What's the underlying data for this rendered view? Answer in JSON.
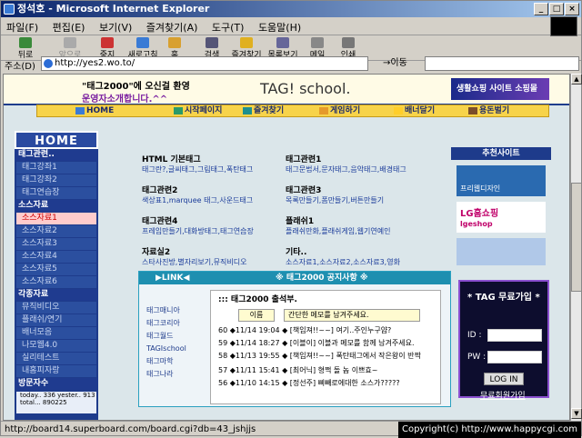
{
  "window": {
    "title": "정석호 - Microsoft Internet Explorer"
  },
  "menu": [
    "파일(F)",
    "편집(E)",
    "보기(V)",
    "즐겨찾기(A)",
    "도구(T)",
    "도움말(H)"
  ],
  "toolbar": [
    "뒤로",
    "앞으로",
    "중지",
    "새로고침",
    "홈",
    "검색",
    "즐겨찾기",
    "목록보기",
    "메일",
    "인쇄"
  ],
  "address": {
    "label": "주소(D)",
    "url": "http://yes2.wo.to/",
    "go": "이동"
  },
  "banner": {
    "line1": "\"태그2000\"에 오신걸 환영",
    "line2": "운영자소개합니다.^^",
    "brand": "TAG! school.",
    "logo_text": "생활쇼핑 사이트 소핑몰"
  },
  "nav": [
    "HOME",
    "시작페이지",
    "즐겨찾기",
    "게임하기",
    "배너달기",
    "용돈벌기"
  ],
  "left": {
    "home": "HOME",
    "sections": [
      {
        "title": "태그관련..",
        "items": [
          "태그강좌1",
          "태그강좌2",
          "태그연습장"
        ]
      },
      {
        "title": "소스자료",
        "items": [
          "소스자료1",
          "소스자료2",
          "소스자료3",
          "소스자료4",
          "소스자료5",
          "소스자료6"
        ]
      },
      {
        "title": "각종자료",
        "items": [
          "뮤직비디오",
          "플래쉬/연기",
          "배너모음",
          "나모웹4.0",
          "실리테스트",
          "내홈피자랑"
        ]
      },
      {
        "title": "방문자수",
        "items": []
      }
    ],
    "visit_text": "today.. 336 yester.. 913 total... 890225"
  },
  "categories": [
    {
      "title": "HTML 기본태그",
      "links": "태그란?,글씨태그,그림태그,폭탄태그"
    },
    {
      "title": "태그관련1",
      "links": "태그문법서,문자태그,음악태그,배경태그"
    },
    {
      "title": "태그관련2",
      "links": "색상표1,marquee 태그,사운드태그"
    },
    {
      "title": "태그관련3",
      "links": "목록만들기,폼만들기,버튼만들기"
    },
    {
      "title": "태그관련4",
      "links": "프레임만들기,대화방태그,태그연습장"
    },
    {
      "title": "플래쉬1",
      "links": "플래쉬만화,플래쉬게임,웹기연예인"
    },
    {
      "title": "자료실2",
      "links": "스타사진방,별자리보기,뮤직비디오"
    },
    {
      "title": "기타..",
      "links": "소스자료1,소스자료2,소스자료3,영화"
    }
  ],
  "recommend": {
    "title": "추천사이트",
    "s1": "프리웹디자인",
    "s2": "LG홈쇼핑",
    "s3": "lgeshop"
  },
  "board": {
    "header_link": "▶LINK◀",
    "header_title": "※ 태그2000 공지사항 ※",
    "links": [
      "태그매니아",
      "태그코리아",
      "태그월드",
      "TAGIschool",
      "태그마학",
      "태그나라"
    ],
    "title": "::: 태그2000 출석부.",
    "cols": [
      "이름",
      "간단한 메모를 남겨주세요."
    ],
    "rows": [
      "60 ◆11/14 19:04 ◆ [책임져!!~~] 여기..주인누구얌?",
      "59 ◆11/14 18:27 ◆ [이블이] 이블과 메모를 함께 남겨주세요.",
      "58 ◆11/13 19:55 ◆ [책임져!!~~] 폭탄태그에서 작은왕이 반짝",
      "57 ◆11/11 15:41 ◆ [최어닉] 형쩍 돌 놈 이쁘효~",
      "56 ◆11/10 14:15 ◆ [정선주] 삐빼로에대한 소스가?????"
    ]
  },
  "login": {
    "title": "* TAG 무료가입 *",
    "id": "ID :",
    "pw": "PW :",
    "button": "LOG IN",
    "join": "무료회원가입"
  },
  "status": {
    "url": "http://board14.superboard.com/board.cgi?db=43_jshjjs",
    "copy": "Copyright(c) http://www.happycgi.com"
  }
}
